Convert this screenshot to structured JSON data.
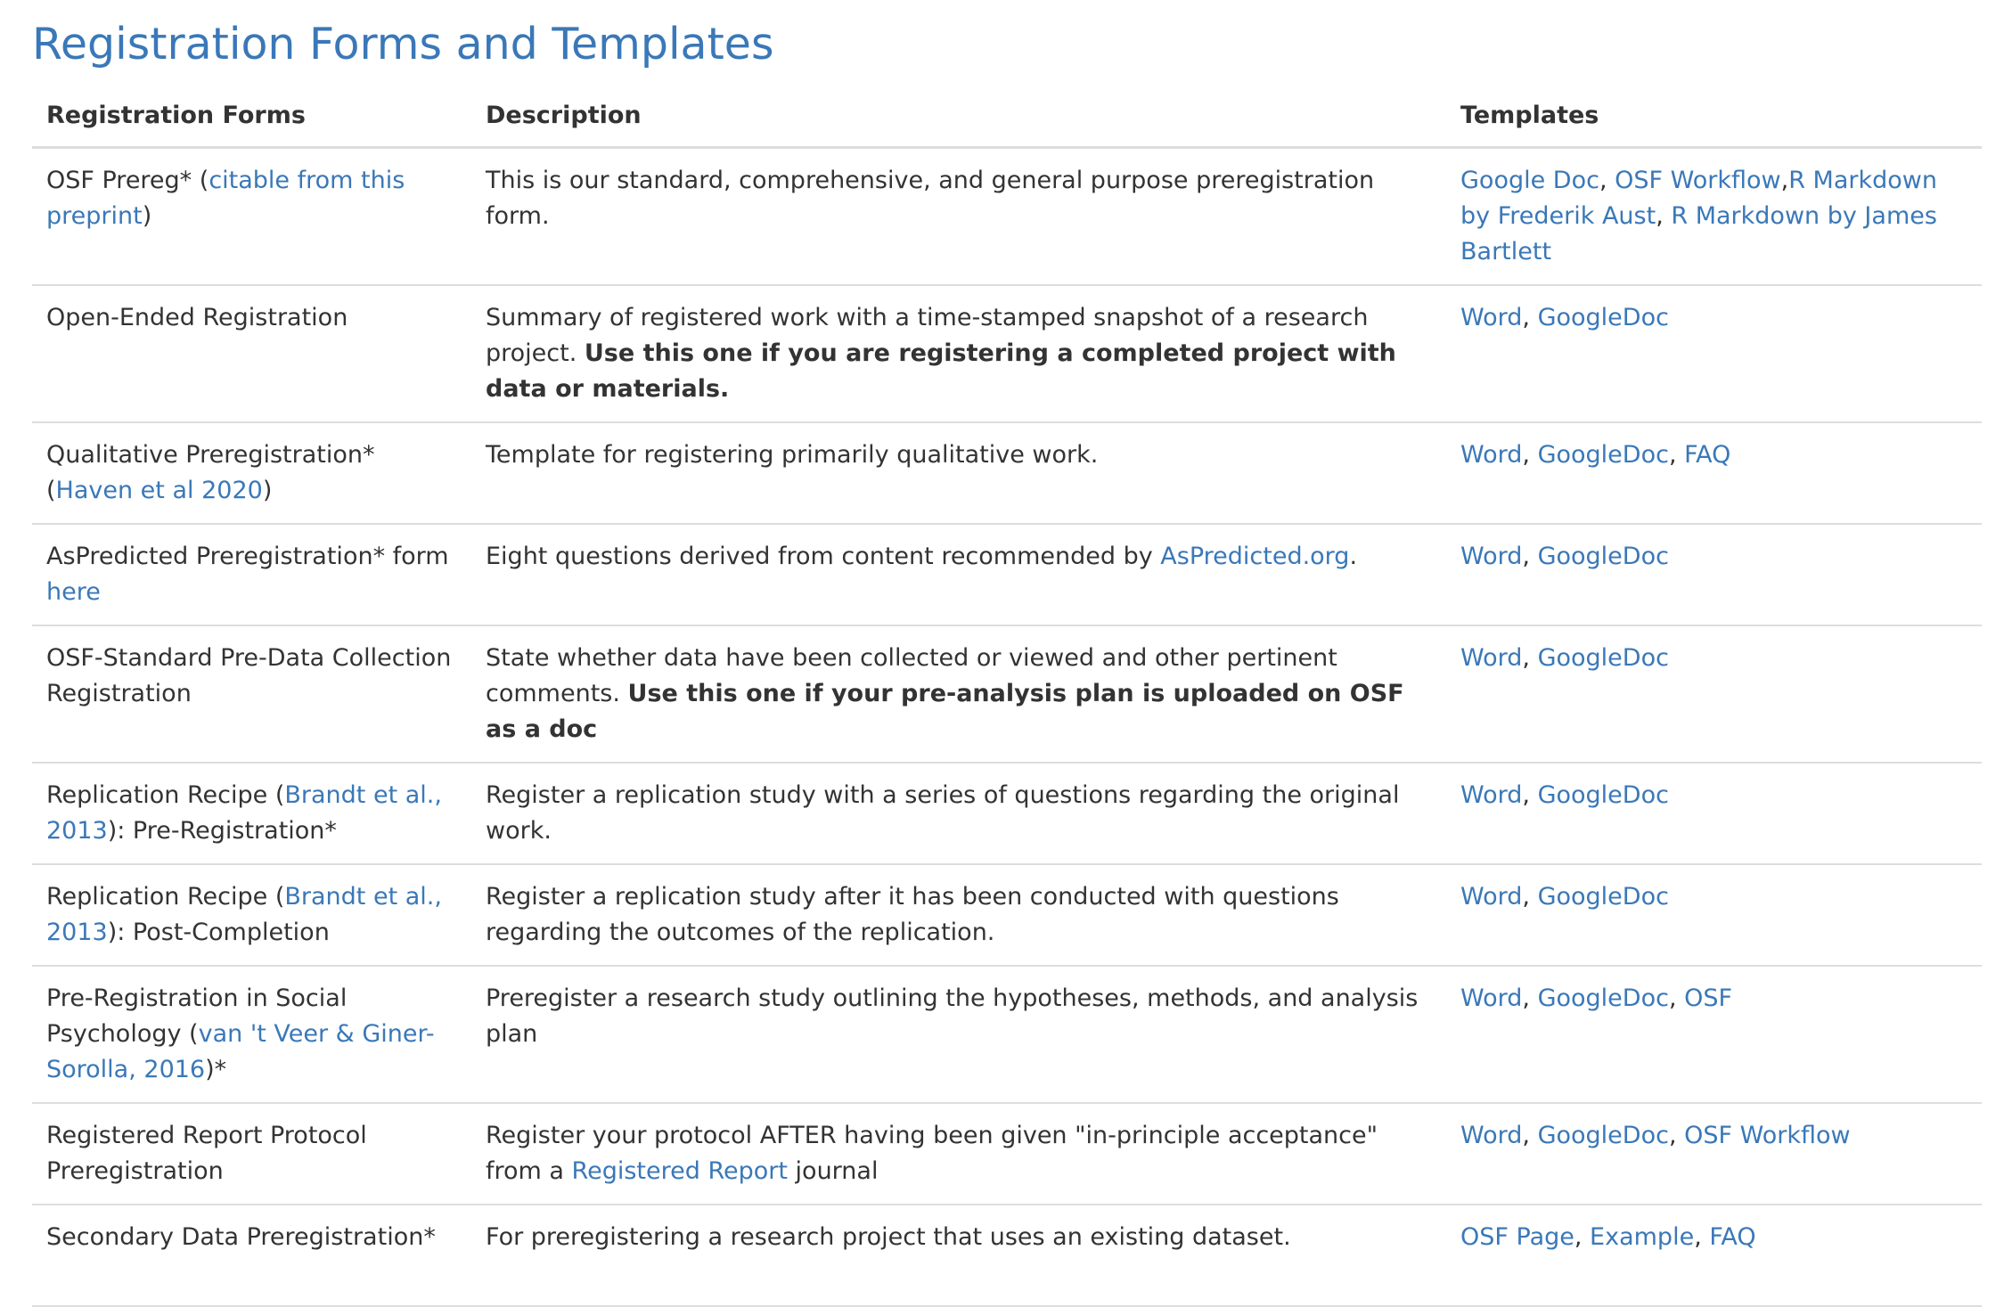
{
  "page_title": "Registration Forms and Templates",
  "columns": [
    "Registration Forms",
    "Description",
    "Templates"
  ],
  "rows": [
    {
      "form": [
        {
          "t": "OSF Prereg* ("
        },
        {
          "t": "citable from this preprint",
          "link": true
        },
        {
          "t": ")"
        }
      ],
      "desc": [
        {
          "t": "This is our standard, comprehensive, and general purpose preregistration form."
        }
      ],
      "templates": [
        {
          "t": "Google Doc",
          "link": true
        },
        {
          "t": ", "
        },
        {
          "t": "OSF Workflow",
          "link": true
        },
        {
          "t": ","
        },
        {
          "t": "R Markdown by Frederik Aust",
          "link": true
        },
        {
          "t": ", "
        },
        {
          "t": "R Markdown by James Bartlett",
          "link": true
        }
      ]
    },
    {
      "form": [
        {
          "t": "Open-Ended Registration"
        }
      ],
      "desc": [
        {
          "t": "Summary of registered work with a time-stamped snapshot of a research project. "
        },
        {
          "t": "Use this one if you are registering a completed project with data or materials.",
          "bold": true
        }
      ],
      "templates": [
        {
          "t": "Word",
          "link": true
        },
        {
          "t": ", "
        },
        {
          "t": "GoogleDoc",
          "link": true
        }
      ]
    },
    {
      "form": [
        {
          "t": "Qualitative Preregistration* ("
        },
        {
          "t": "Haven et al 2020",
          "link": true
        },
        {
          "t": ")"
        }
      ],
      "desc": [
        {
          "t": "Template for registering primarily qualitative work."
        }
      ],
      "templates": [
        {
          "t": "Word",
          "link": true
        },
        {
          "t": ", "
        },
        {
          "t": "GoogleDoc",
          "link": true
        },
        {
          "t": ", "
        },
        {
          "t": "FAQ",
          "link": true
        }
      ]
    },
    {
      "form": [
        {
          "t": "AsPredicted Preregistration* form "
        },
        {
          "t": "here",
          "link": true
        }
      ],
      "desc": [
        {
          "t": "Eight questions derived from content recommended by "
        },
        {
          "t": "AsPredicted.org",
          "link": true
        },
        {
          "t": "."
        }
      ],
      "templates": [
        {
          "t": "Word",
          "link": true
        },
        {
          "t": ", "
        },
        {
          "t": "GoogleDoc",
          "link": true
        }
      ]
    },
    {
      "form": [
        {
          "t": "OSF-Standard Pre-Data Collection Registration"
        }
      ],
      "desc": [
        {
          "t": "State whether data have been collected or viewed and other pertinent comments. "
        },
        {
          "t": "Use this one if your pre-analysis plan is uploaded on OSF as a doc",
          "bold": true
        }
      ],
      "templates": [
        {
          "t": "Word",
          "link": true
        },
        {
          "t": ", "
        },
        {
          "t": "GoogleDoc",
          "link": true
        }
      ]
    },
    {
      "form": [
        {
          "t": "Replication Recipe ("
        },
        {
          "t": "Brandt et al., 2013",
          "link": true
        },
        {
          "t": "): Pre-Registration*"
        }
      ],
      "desc": [
        {
          "t": "Register a replication study with a series of questions regarding the original work."
        }
      ],
      "templates": [
        {
          "t": "Word",
          "link": true
        },
        {
          "t": ", "
        },
        {
          "t": "GoogleDoc",
          "link": true
        }
      ]
    },
    {
      "form": [
        {
          "t": "Replication Recipe ("
        },
        {
          "t": "Brandt et al., 2013",
          "link": true
        },
        {
          "t": "): Post-Completion"
        }
      ],
      "desc": [
        {
          "t": "Register a replication study after it has been conducted with questions regarding the outcomes of the replication."
        }
      ],
      "templates": [
        {
          "t": "Word",
          "link": true
        },
        {
          "t": ", "
        },
        {
          "t": "GoogleDoc",
          "link": true
        }
      ]
    },
    {
      "form": [
        {
          "t": "Pre-Registration in Social Psychology ("
        },
        {
          "t": "van 't Veer & Giner-Sorolla, 2016",
          "link": true
        },
        {
          "t": ")*"
        }
      ],
      "desc": [
        {
          "t": "Preregister a research study outlining the hypotheses, methods, and analysis plan"
        }
      ],
      "templates": [
        {
          "t": "Word",
          "link": true
        },
        {
          "t": ", "
        },
        {
          "t": "GoogleDoc",
          "link": true
        },
        {
          "t": ", "
        },
        {
          "t": "OSF",
          "link": true
        }
      ]
    },
    {
      "form": [
        {
          "t": "Registered Report Protocol Preregistration"
        }
      ],
      "desc": [
        {
          "t": "Register your protocol AFTER having been given \"in-principle acceptance\" from a "
        },
        {
          "t": "Registered Report",
          "link": true
        },
        {
          "t": " journal"
        }
      ],
      "templates": [
        {
          "t": "Word",
          "link": true
        },
        {
          "t": ", "
        },
        {
          "t": "GoogleDoc",
          "link": true
        },
        {
          "t": ", "
        },
        {
          "t": "OSF Workflow",
          "link": true
        }
      ]
    },
    {
      "form": [
        {
          "t": "Secondary Data Preregistration*"
        }
      ],
      "desc": [
        {
          "t": "For preregistering a research project that uses an existing dataset."
        }
      ],
      "templates": [
        {
          "t": "OSF Page",
          "link": true
        },
        {
          "t": ", "
        },
        {
          "t": "Example",
          "link": true
        },
        {
          "t": ", "
        },
        {
          "t": "FAQ",
          "link": true
        }
      ]
    }
  ],
  "colors": {
    "link": "#3a78b8",
    "text": "#333333",
    "rule": "#dddddd"
  }
}
